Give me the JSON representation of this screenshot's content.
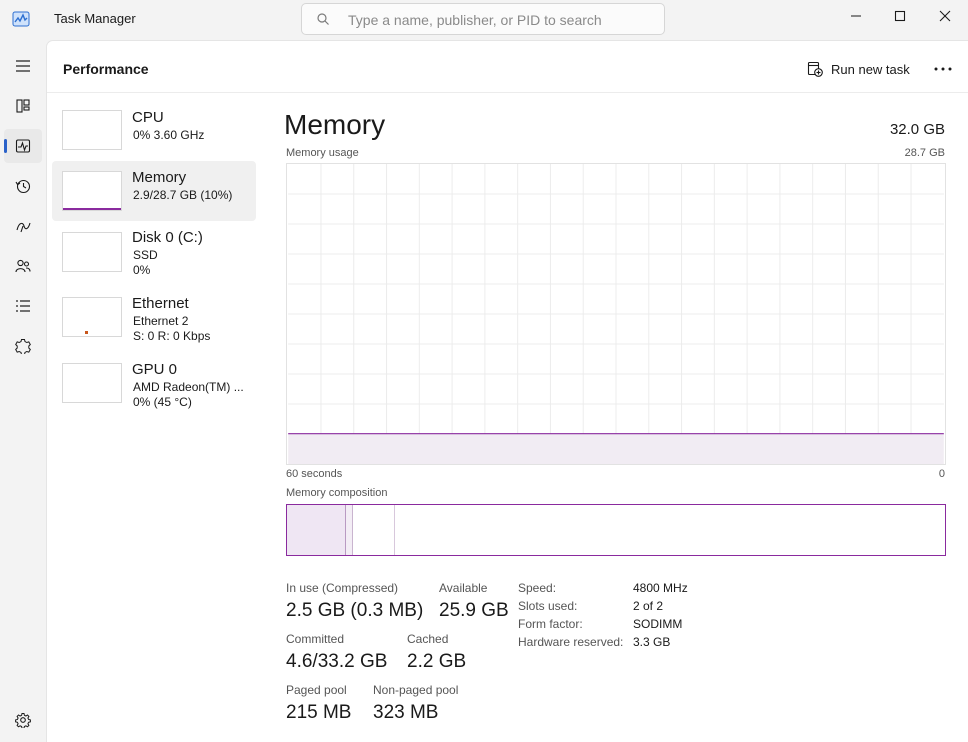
{
  "window": {
    "title": "Task Manager",
    "search_placeholder": "Type a name, publisher, or PID to search"
  },
  "header": {
    "title": "Performance",
    "run_new_task": "Run new task"
  },
  "devices": [
    {
      "name": "CPU",
      "line1": "0%  3.60 GHz",
      "line2": ""
    },
    {
      "name": "Memory",
      "line1": "2.9/28.7 GB (10%)",
      "line2": ""
    },
    {
      "name": "Disk 0 (C:)",
      "line1": "SSD",
      "line2": "0%"
    },
    {
      "name": "Ethernet",
      "line1": "Ethernet 2",
      "line2": "S: 0  R: 0 Kbps"
    },
    {
      "name": "GPU 0",
      "line1": "AMD Radeon(TM) ...",
      "line2": "0%  (45 °C)"
    }
  ],
  "memory": {
    "title": "Memory",
    "total": "32.0 GB",
    "usage_label": "Memory usage",
    "usage_max": "28.7 GB",
    "time_span": "60 seconds",
    "axis_zero": "0",
    "usage_fraction": 0.101,
    "composition_label": "Memory composition",
    "composition": {
      "in_use": 0.089,
      "modified": 0.012,
      "standby": 0.063,
      "free": 0.836
    },
    "stats": {
      "in_use_label": "In use (Compressed)",
      "in_use_value": "2.5 GB (0.3 MB)",
      "available_label": "Available",
      "available_value": "25.9 GB",
      "committed_label": "Committed",
      "committed_value": "4.6/33.2 GB",
      "cached_label": "Cached",
      "cached_value": "2.2 GB",
      "paged_label": "Paged pool",
      "paged_value": "215 MB",
      "nonpaged_label": "Non-paged pool",
      "nonpaged_value": "323 MB"
    },
    "details": [
      {
        "key": "Speed:",
        "value": "4800 MHz"
      },
      {
        "key": "Slots used:",
        "value": "2 of 2"
      },
      {
        "key": "Form factor:",
        "value": "SODIMM"
      },
      {
        "key": "Hardware reserved:",
        "value": "3.3 GB"
      }
    ]
  },
  "colors": {
    "memory_accent": "#8a2a9e",
    "memory_fill": "#f1ecf3",
    "active_indicator": "#2b62c9"
  }
}
